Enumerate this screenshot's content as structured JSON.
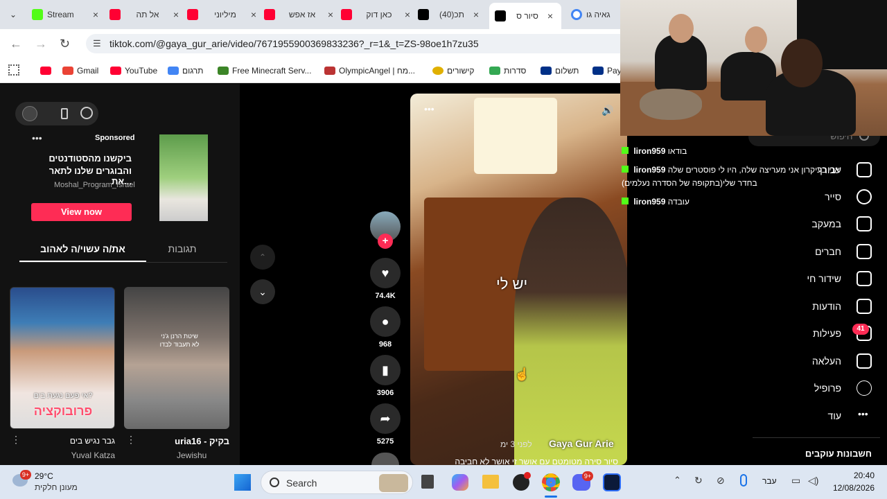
{
  "tabs": [
    {
      "title": "Stream",
      "color": "#53fc18"
    },
    {
      "title": "אל תה",
      "color": "#ff0033"
    },
    {
      "title": "מיליוני",
      "color": "#ff0033"
    },
    {
      "title": "אז אפש",
      "color": "#ff0033"
    },
    {
      "title": "כאן דוק",
      "color": "#ff0033"
    },
    {
      "title": "(40)תכ",
      "color": "#000000"
    },
    {
      "title": "סיור ס",
      "color": "#000000"
    },
    {
      "title": "גאיה גו",
      "color": "#4285f4"
    }
  ],
  "url": "tiktok.com/@gaya_gur_arie/video/7671955900369833236?_r=1&_t=ZS-98oe1h7zu35",
  "bookmarks": [
    "Gmail",
    "YouTube",
    "תרגום",
    "Free Minecraft Serv...",
    "OlympicAngel | מח...",
    "קישורים",
    "סדרות",
    "תשלום",
    "Payl"
  ],
  "ad": {
    "sponsored": "Sponsored",
    "line1": "ביקשנו מהסטודנטים",
    "line2": "והבוגרים שלנו לתאר את...",
    "account": "Moshal_Program_Israel",
    "cta": "View now"
  },
  "panel_tabs": {
    "for_you": "את/ה עשוי/ה לאהוב",
    "comments": "תגובות"
  },
  "suggested": [
    {
      "title": "גבר נגיש בים",
      "author": "Yuval Katza",
      "caption1": "אי פעם נגעת בים?",
      "caption2": "פרובוקציה"
    },
    {
      "title": "uria16 - בקיק",
      "author": "Jewishu",
      "caption1": "שיטת הרנן ג'ני",
      "caption2": "לא תעבוד לבדו"
    }
  ],
  "actions": {
    "likes": "74.4K",
    "comments": "968",
    "saves": "3906",
    "shares": "5275"
  },
  "video": {
    "overlay_text": "יש לי",
    "author": "Gaya Gur Arie",
    "posted": "לפני 3 ימ",
    "desc": "סיור סירה מטומטם עם אושר זי אושר לא חביבה"
  },
  "sidebar": {
    "search_placeholder": "חיפוש",
    "items": [
      "עבורך",
      "סייר",
      "במעקב",
      "חברים",
      "שידור חי",
      "הודעות",
      "פעילות",
      "העלאה",
      "פרופיל",
      "עוד"
    ],
    "activity_badge": "41",
    "following_accounts": "חשבונות עוקבים"
  },
  "chat": [
    {
      "name": "liron959",
      "text": "בודאו"
    },
    {
      "name": "liron959",
      "text": "אני בעיקרון אני מעריצה שלה, היו לי פוסטרים שלה"
    },
    {
      "name": "",
      "text": "בחדר שלי(בתקופה של הסדרה נעלמים)"
    },
    {
      "name": "liron959",
      "text": "עובדה"
    }
  ],
  "taskbar": {
    "temp": "29°C",
    "weather": "מעונן חלקית",
    "search": "Search",
    "lang": "עבר",
    "time": "20:40",
    "date": "12/08/2026",
    "weather_badge": "9+",
    "discord_badge": "9+"
  }
}
